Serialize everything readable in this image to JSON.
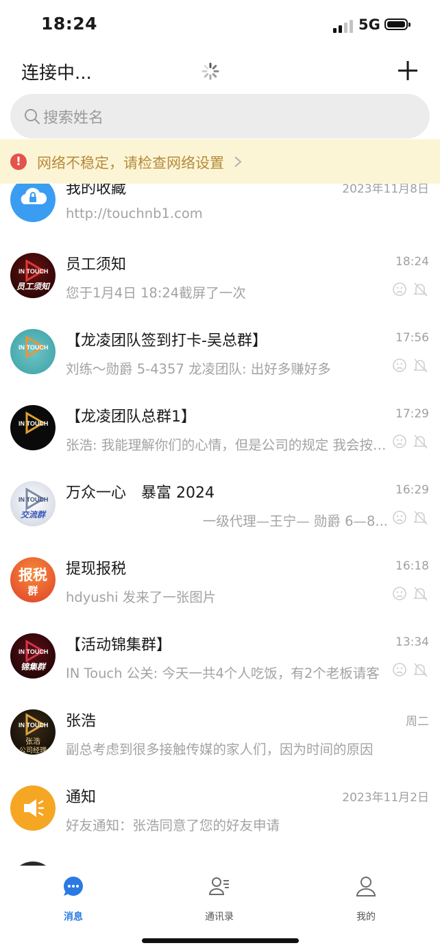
{
  "status_bar": {
    "time": "18:24",
    "network": "5G"
  },
  "header": {
    "title": "连接中...",
    "add_icon": "plus-icon"
  },
  "search": {
    "placeholder": "搜索姓名"
  },
  "banner": {
    "text": "网络不稳定，请检查网络设置"
  },
  "chats": [
    {
      "name": "我的收藏",
      "time": "2023年11月8日",
      "preview": "http://touchnb1.com"
    },
    {
      "name": "员工须知",
      "time": "18:24",
      "preview": "您于1月4日 18:24截屏了一次",
      "avatar_text": "员工须知"
    },
    {
      "name": "【龙凌团队签到打卡-吴总群】",
      "time": "17:56",
      "preview": "刘练～勋爵 5-4357 龙凌团队: 出好多赚好多"
    },
    {
      "name": "【龙凌团队总群1】",
      "time": "17:29",
      "preview": "张浩: 我能理解你们的心情，但是公司的规定 我会按照公司的规定执行"
    },
    {
      "name": "万众一心　暴富 2024",
      "time": "16:29",
      "preview": "一级代理—王宁— 勋爵 6—8...",
      "avatar_text": "交流群"
    },
    {
      "name": "提现报税",
      "time": "16:18",
      "preview": "hdyushi 发来了一张图片",
      "avatar_text": "报税",
      "avatar_text2": "群"
    },
    {
      "name": "【活动锦集群】",
      "time": "13:34",
      "preview": "IN Touch 公关: 今天一共4个人吃饭，有2个老板请客",
      "avatar_text": "锦集群"
    },
    {
      "name": "张浩",
      "time": "周二",
      "preview": "副总考虑到很多接触传媒的家人们，因为时间的原因",
      "avatar_text": "张浩",
      "avatar_text2": "公司经理"
    },
    {
      "name": "通知",
      "time": "2023年11月2日",
      "preview": "好友通知：张浩同意了您的好友申请"
    }
  ],
  "tabs": [
    {
      "label": "消息",
      "icon": "chat-bubble-icon",
      "active": true
    },
    {
      "label": "通讯录",
      "icon": "contacts-icon",
      "active": false
    },
    {
      "label": "我的",
      "icon": "person-icon",
      "active": false
    }
  ],
  "colors": {
    "accent": "#2a7ae2",
    "banner_bg": "#fcf5d5",
    "banner_text": "#b58a3c",
    "warning": "#e5534b"
  }
}
